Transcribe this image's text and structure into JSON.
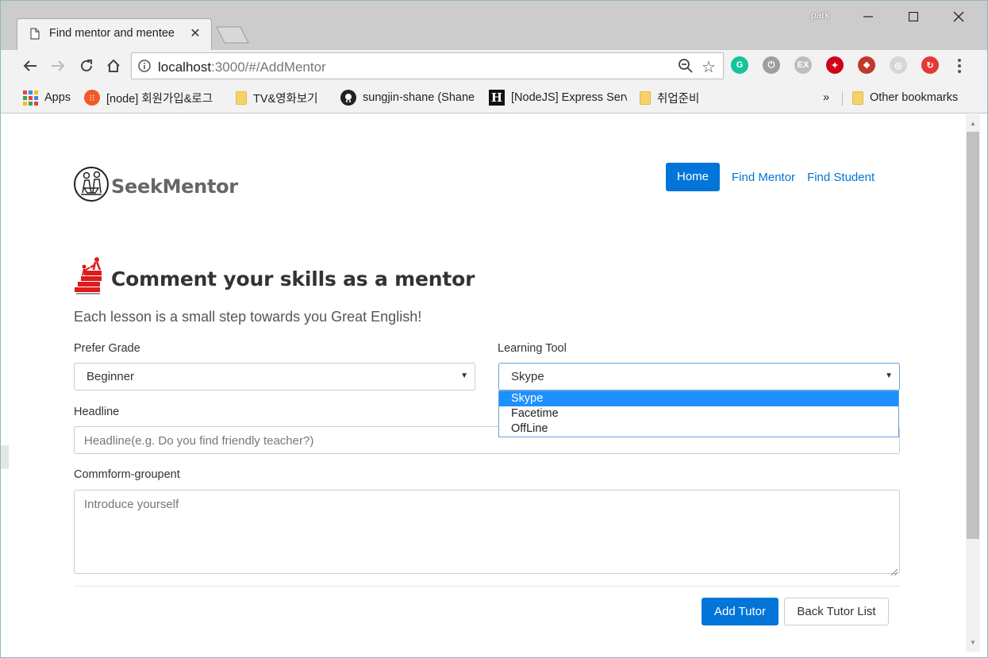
{
  "browser": {
    "tab_title": "Find mentor and mentee",
    "profile_name": "park",
    "url_host": "localhost",
    "url_rest": ":3000/#/AddMentor",
    "extensions": [
      {
        "name": "grammarly-icon",
        "color": "#15c39a",
        "glyph": "G"
      },
      {
        "name": "power-icon",
        "color": "#9e9e9e",
        "glyph": "⏻"
      },
      {
        "name": "ex-icon",
        "color": "#bdbdbd",
        "glyph": "EX"
      },
      {
        "name": "trend-micro-icon",
        "color": "#d0021b",
        "glyph": "✦"
      },
      {
        "name": "red-app-icon",
        "color": "#c0392b",
        "glyph": "❖"
      },
      {
        "name": "gray-circle-icon",
        "color": "#d6d6d6",
        "glyph": "◎"
      },
      {
        "name": "sync-icon",
        "color": "#e53935",
        "glyph": "↻"
      }
    ]
  },
  "bookmarks": [
    {
      "label": "Apps"
    },
    {
      "label": "[node] 회원가입&로그"
    },
    {
      "label": "TV&영화보기"
    },
    {
      "label": "sungjin-shane (Shane"
    },
    {
      "label": "[NodeJS] Express Serv"
    },
    {
      "label": "취업준비"
    }
  ],
  "bookmarks_more": "»",
  "other_bookmarks": "Other bookmarks",
  "site": {
    "brand": "SeekMentor",
    "nav": {
      "home": "Home",
      "find_mentor": "Find Mentor",
      "find_student": "Find Student"
    }
  },
  "form": {
    "heading": "Comment your skills as a mentor",
    "lead": "Each lesson is a small step towards you Great English!",
    "prefer_grade_label": "Prefer Grade",
    "prefer_grade_value": "Beginner",
    "learning_tool_label": "Learning Tool",
    "learning_tool_value": "Skype",
    "learning_tool_options": [
      "Skype",
      "Facetime",
      "OffLine"
    ],
    "headline_label": "Headline",
    "headline_placeholder": "Headline(e.g. Do you find friendly teacher?)",
    "comment_label": "Commform-groupent",
    "comment_placeholder": "Introduce yourself",
    "submit": "Add Tutor",
    "back": "Back Tutor List"
  }
}
